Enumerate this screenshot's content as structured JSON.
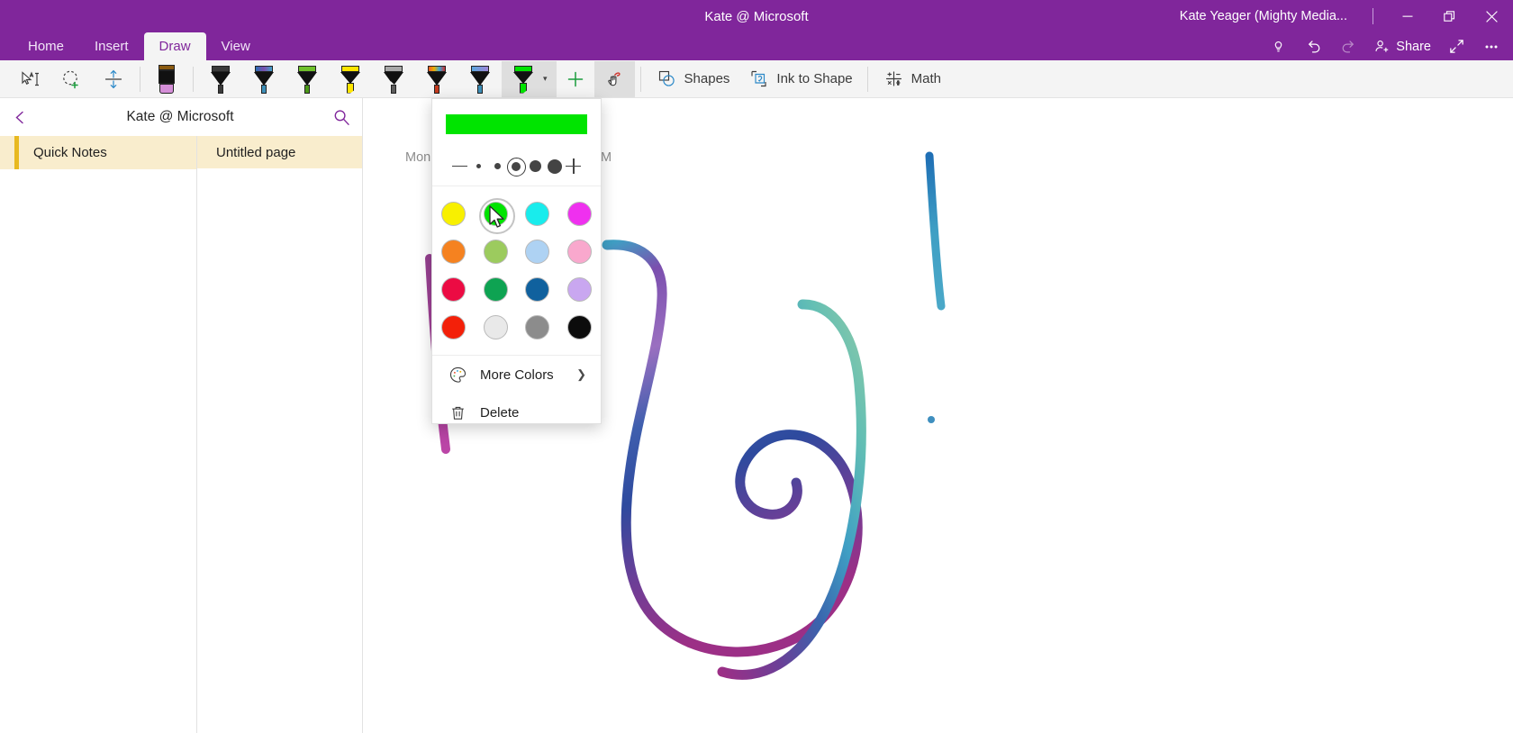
{
  "window": {
    "document_title": "Kate @ Microsoft",
    "account_name": "Kate Yeager (Mighty Media...",
    "minimize_label": "Minimize",
    "restore_label": "Restore",
    "close_label": "Close",
    "accent_color": "#80269b"
  },
  "ribbon": {
    "tabs": [
      {
        "label": "Home",
        "active": false
      },
      {
        "label": "Insert",
        "active": false
      },
      {
        "label": "Draw",
        "active": true
      },
      {
        "label": "View",
        "active": false
      }
    ],
    "right_actions": [
      {
        "label": "Tell me what you want to do",
        "icon": "lightbulb-icon"
      },
      {
        "label": "Undo",
        "icon": "undo-icon"
      },
      {
        "label": "Redo",
        "icon": "redo-icon"
      },
      {
        "label": "Share",
        "icon": "share-person-icon"
      },
      {
        "label": "Full screen",
        "icon": "expand-icon"
      },
      {
        "label": "More options",
        "icon": "ellipsis-icon"
      }
    ],
    "share_label": "Share"
  },
  "drawbar": {
    "tools": [
      {
        "name": "type-select-tool",
        "label": "Type / Select"
      },
      {
        "name": "lasso-select-tool",
        "label": "Lasso Select"
      },
      {
        "name": "insert-space-tool",
        "label": "Insert Space"
      }
    ],
    "eraser_label": "Eraser",
    "pens": [
      {
        "label": "Black pen",
        "cap": "#3a3a3a",
        "tip": "#3a3a3a",
        "type": "pen"
      },
      {
        "label": "Galaxy pen",
        "cap": "linear-gradient(90deg,#2a6fb5,#7b4fae,#43a0c8)",
        "tip": "#3d8fb8",
        "type": "pen"
      },
      {
        "label": "Green pen",
        "cap": "#6fc12b",
        "tip": "#4c9a18",
        "type": "pen"
      },
      {
        "label": "Yellow highlighter",
        "cap": "#ffe500",
        "tip": "#ffe500",
        "type": "highlighter"
      },
      {
        "label": "Silver pencil",
        "cap": "#a8a8a8",
        "tip": "#5c5c5c",
        "type": "pencil"
      },
      {
        "label": "Rainbow pen",
        "cap": "linear-gradient(90deg,#f25c2a,#e8b000,#3aa6d6,#d02f2f)",
        "tip": "#c63b1e",
        "type": "pen"
      },
      {
        "label": "Blue pen",
        "cap": "linear-gradient(90deg,#5aa7dd,#9f86d8)",
        "tip": "#3d8fb8",
        "type": "pen"
      }
    ],
    "active_pen": {
      "label": "Green highlighter",
      "cap": "#00e400",
      "tip": "#00e400",
      "type": "highlighter"
    },
    "add_pen_label": "Add pen",
    "ink_to_text_label": "Ink to Text",
    "shapes_label": "Shapes",
    "ink_to_shape_label": "Ink to Shape",
    "math_label": "Math"
  },
  "navigation": {
    "back_label": "Back",
    "notebook_title": "Kate @ Microsoft",
    "search_label": "Search",
    "sections": [
      {
        "label": "Quick Notes",
        "color": "#e8b920",
        "selected": true
      }
    ],
    "pages": [
      {
        "label": "Untitled page",
        "selected": true
      }
    ]
  },
  "canvas": {
    "page_date_left": "Mon",
    "page_date_right": "M"
  },
  "color_flyout": {
    "preview_color": "#00e400",
    "thickness": {
      "decrease_label": "Decrease thickness",
      "increase_label": "Increase thickness",
      "options": [
        {
          "label": "Extra fine",
          "size": 5,
          "selected": false
        },
        {
          "label": "Fine",
          "size": 7,
          "selected": false
        },
        {
          "label": "Medium",
          "size": 10,
          "selected": true
        },
        {
          "label": "Thick",
          "size": 13,
          "selected": false
        },
        {
          "label": "Extra thick",
          "size": 16,
          "selected": false
        }
      ]
    },
    "swatches": [
      {
        "label": "Yellow",
        "hex": "#f8f000",
        "selected": false
      },
      {
        "label": "Bright Green",
        "hex": "#00e400",
        "selected": true
      },
      {
        "label": "Cyan",
        "hex": "#19ecec",
        "selected": false
      },
      {
        "label": "Magenta",
        "hex": "#ef30ef",
        "selected": false
      },
      {
        "label": "Orange",
        "hex": "#f58220",
        "selected": false
      },
      {
        "label": "Light Green",
        "hex": "#9ccb5e",
        "selected": false
      },
      {
        "label": "Light Blue",
        "hex": "#aed2f3",
        "selected": false
      },
      {
        "label": "Pink",
        "hex": "#f9a8cd",
        "selected": false
      },
      {
        "label": "Crimson",
        "hex": "#ec0b43",
        "selected": false
      },
      {
        "label": "Green",
        "hex": "#0ea352",
        "selected": false
      },
      {
        "label": "Blue",
        "hex": "#10619e",
        "selected": false
      },
      {
        "label": "Lavender",
        "hex": "#c9a7f0",
        "selected": false
      },
      {
        "label": "Red",
        "hex": "#f32009",
        "selected": false
      },
      {
        "label": "White",
        "hex": "#e9e9e9",
        "selected": false
      },
      {
        "label": "Gray",
        "hex": "#8c8c8c",
        "selected": false
      },
      {
        "label": "Black",
        "hex": "#0c0c0c",
        "selected": false
      }
    ],
    "more_colors_label": "More Colors",
    "delete_label": "Delete"
  }
}
